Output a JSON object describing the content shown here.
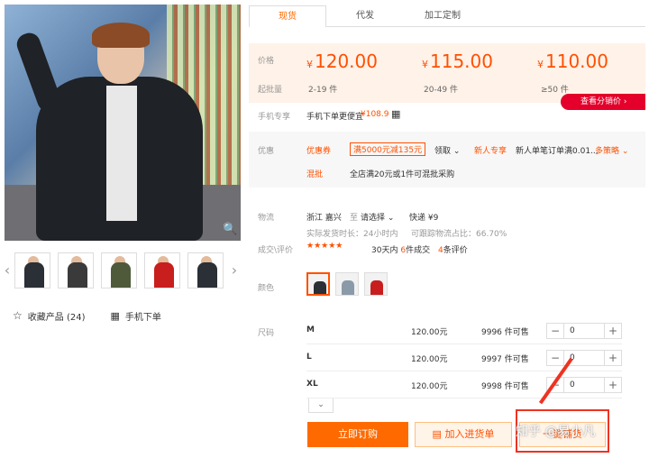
{
  "gallery": {
    "thumbs": [
      {
        "color": "#2b2f36"
      },
      {
        "color": "#3a3a3a"
      },
      {
        "color": "#4e5a3a"
      },
      {
        "color": "#c81e1e"
      },
      {
        "color": "#2b2f36"
      }
    ],
    "favorite_label": "收藏产品 (24)",
    "mobile_order_label": "手机下单"
  },
  "tabs": [
    "现货",
    "代发",
    "加工定制"
  ],
  "pricing": {
    "price_label": "价格",
    "qty_label": "起批量",
    "tiers": [
      {
        "price": "120.00",
        "qty": "2-19 件"
      },
      {
        "price": "115.00",
        "qty": "20-49 件"
      },
      {
        "price": "110.00",
        "qty": "≥50 件"
      }
    ],
    "currency": "¥",
    "distributor_btn": "查看分销价"
  },
  "mobile": {
    "label": "手机专享",
    "text": "手机下单更便宜",
    "price": "¥108.9"
  },
  "promo": {
    "label": "优惠",
    "coupon_label": "优惠券",
    "coupon_tag": "满5000元减135元",
    "claim": "领取",
    "new_user_label": "新人专享",
    "new_user_text": "新人单笔订单满0.01...",
    "more": "多策略",
    "mix_label": "混批",
    "mix_text": "全店满20元或1件可混批采购"
  },
  "shipping": {
    "label": "物流",
    "from": "浙江 嘉兴",
    "to_word": "至",
    "select": "请选择",
    "express": "快递 ¥9",
    "dispatch": "实际发货时长：24小时内",
    "rate": "可跟踪物流占比：66.70%",
    "review_label": "成交\\评价",
    "stars": "★★★★★",
    "deals_prefix": "30天内",
    "deals_count": "6",
    "deals_suffix": "件成交",
    "reviews_count": "4",
    "reviews_suffix": "条评价"
  },
  "color": {
    "label": "颜色",
    "swatches": [
      "#2b2f36",
      "#8a9aa8",
      "#c81e1e"
    ]
  },
  "sizes": {
    "label": "尺码",
    "rows": [
      {
        "name": "M",
        "price": "120.00元",
        "stock": "9996 件可售",
        "value": "0"
      },
      {
        "name": "L",
        "price": "120.00元",
        "stock": "9997 件可售",
        "value": "0"
      },
      {
        "name": "XL",
        "price": "120.00元",
        "stock": "9998 件可售",
        "value": "0"
      }
    ]
  },
  "actions": {
    "buy": "立即订购",
    "cart": "加入进货单",
    "distribute": "一键铺货",
    "watermark": "知乎 @易小凡"
  }
}
